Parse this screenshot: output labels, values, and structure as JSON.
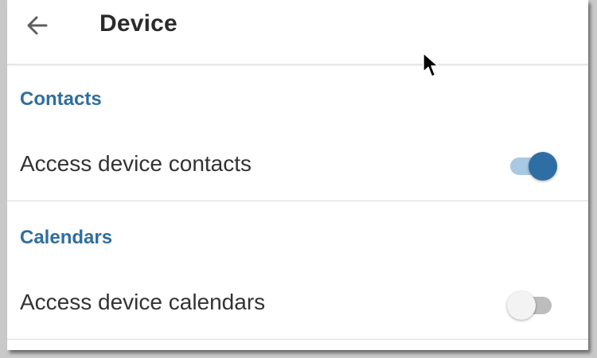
{
  "appbar": {
    "title": "Device",
    "back_icon": "arrow-left-icon"
  },
  "sections": [
    {
      "header": "Contacts",
      "setting": {
        "label": "Access device contacts",
        "enabled": true
      }
    },
    {
      "header": "Calendars",
      "setting": {
        "label": "Access device calendars",
        "enabled": false
      }
    }
  ],
  "colors": {
    "accent": "#2f6ea5",
    "accent_track": "#a9c9e2",
    "section_header": "#2f6e9e",
    "off_track": "#bdbdbd",
    "off_thumb": "#f3f3f3",
    "text": "#333333"
  },
  "pointer": "mouse-pointer-icon"
}
